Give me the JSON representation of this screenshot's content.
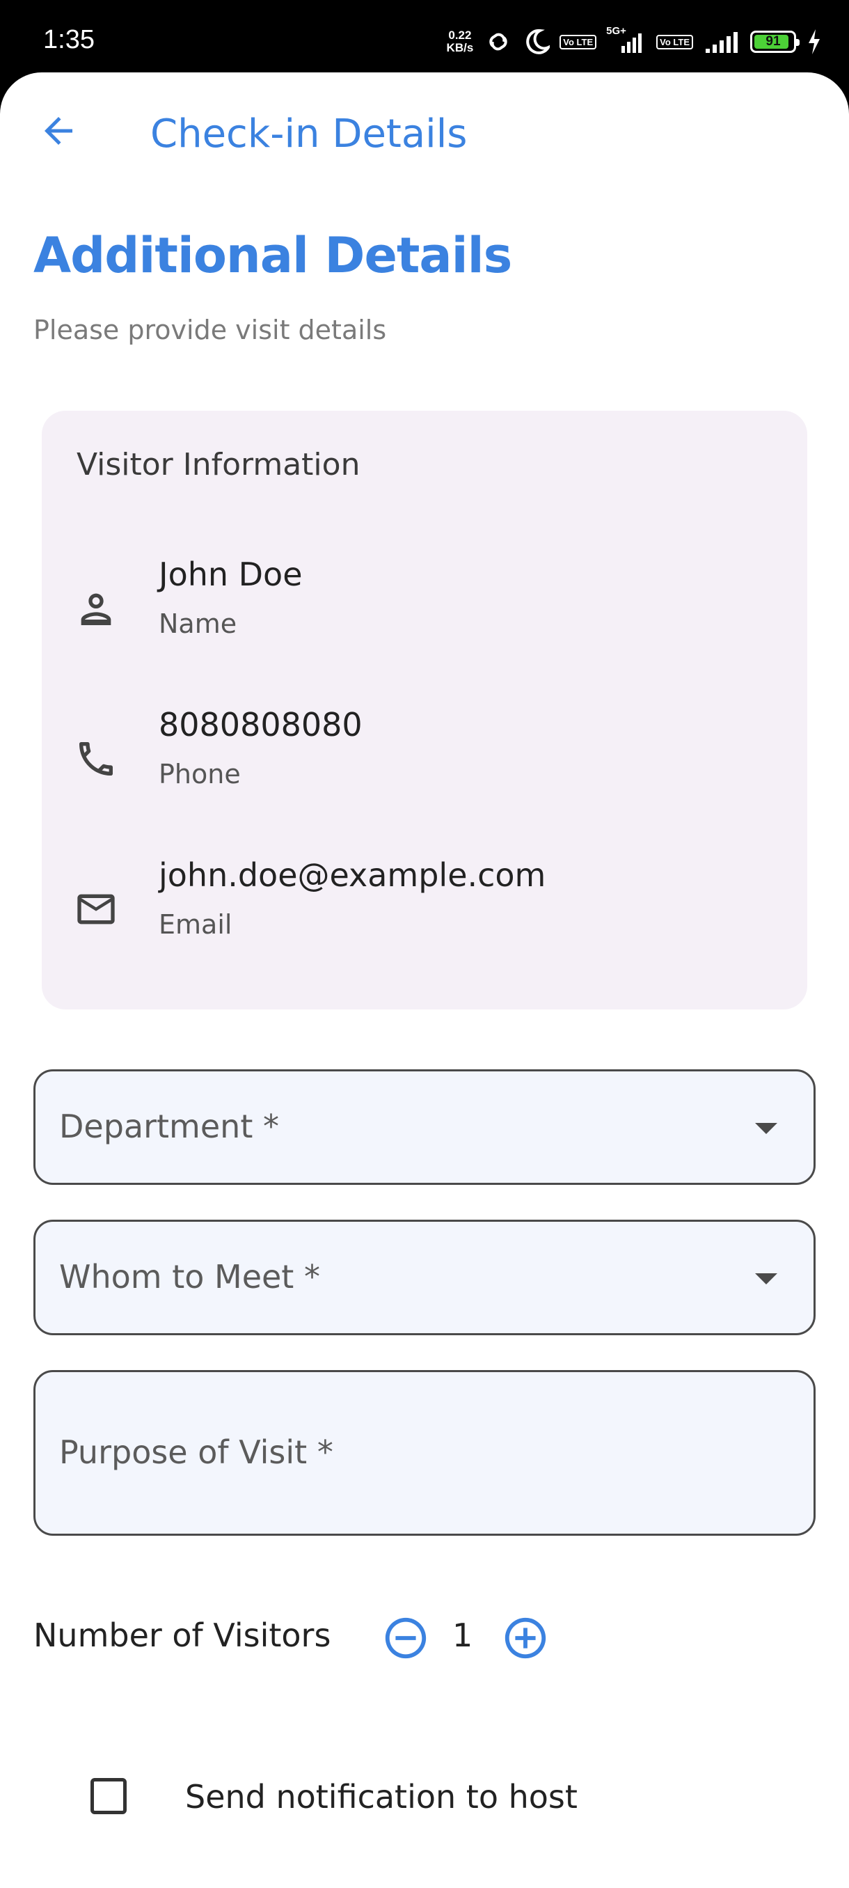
{
  "status_bar": {
    "time": "1:35",
    "net_speed_value": "0.22",
    "net_speed_unit": "KB/s",
    "volte_1": "Vo LTE",
    "network_1": "5G+",
    "volte_2": "Vo LTE",
    "battery_level": "91",
    "battery_fraction": 0.91
  },
  "app_bar": {
    "title": "Check-in Details",
    "back_icon": "arrow-left-icon"
  },
  "page": {
    "heading": "Additional Details",
    "subtitle": "Please provide visit details"
  },
  "visitor_card": {
    "title": "Visitor Information",
    "rows": [
      {
        "icon": "person-icon",
        "value": "John Doe",
        "label": "Name"
      },
      {
        "icon": "phone-icon",
        "value": "8080808080",
        "label": "Phone"
      },
      {
        "icon": "mail-icon",
        "value": "john.doe@example.com",
        "label": "Email"
      }
    ]
  },
  "form": {
    "department_label": "Department *",
    "whom_to_meet_label": "Whom to Meet *",
    "purpose_label": "Purpose of Visit *"
  },
  "visitors": {
    "label": "Number of Visitors",
    "count": "1",
    "decrement_icon": "minus-circle-icon",
    "increment_icon": "plus-circle-icon"
  },
  "notification": {
    "label": "Send notification to host",
    "checked": false
  },
  "colors": {
    "accent": "#3b82e0",
    "card_bg": "#f5f0f7",
    "field_bg": "#f3f6fd",
    "battery_green": "#4cd137"
  }
}
